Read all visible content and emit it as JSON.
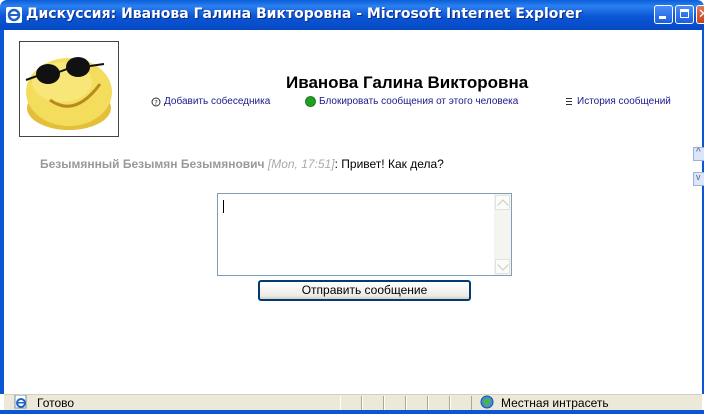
{
  "window": {
    "title": "Дискуссия: Иванова Галина Викторовна - Microsoft Internet Explorer"
  },
  "contact": {
    "name": "Иванова Галина Викторовна"
  },
  "actions": {
    "add_contact": "Добавить собеседника",
    "block_user": "Блокировать сообщения от этого человека",
    "history": "История сообщений"
  },
  "messages": [
    {
      "author": "Безымянный Безымян Безымянович",
      "time": "[Mon, 17:51]",
      "separator": ":",
      "text": "Привет! Как дела?"
    }
  ],
  "composer": {
    "value": "",
    "send_label": "Отправить сообщение"
  },
  "statusbar": {
    "status": "Готово",
    "zone": "Местная интрасеть"
  },
  "colors": {
    "titlebar": "#0b56d4",
    "link": "#1a1a8c",
    "block_indicator": "#1fa01f",
    "author_gray": "#999999"
  }
}
